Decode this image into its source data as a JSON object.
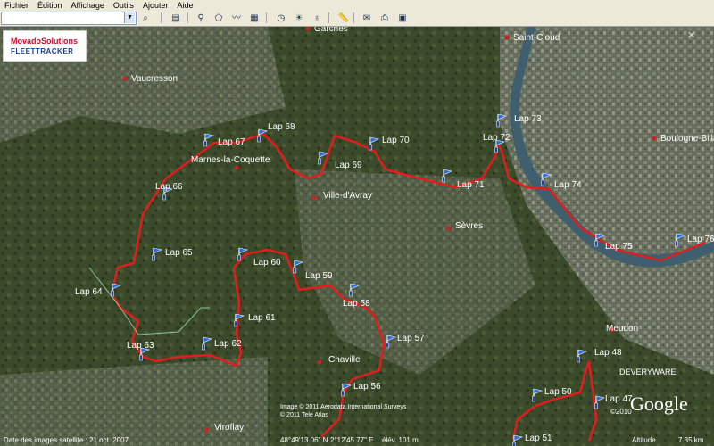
{
  "menu": [
    "Fichier",
    "Édition",
    "Affichage",
    "Outils",
    "Ajouter",
    "Aide"
  ],
  "search": {
    "value": ""
  },
  "toolbar_icons": [
    "sidebar-icon",
    "placemark-icon",
    "polygon-icon",
    "path-icon",
    "overlay-icon",
    "tour-icon",
    "history-icon",
    "sun-icon",
    "planet-icon",
    "ruler-icon",
    "email-icon",
    "print-icon",
    "maps-icon"
  ],
  "logo": {
    "line1": "MovadoSolutions",
    "line2": "FLEETTRACKER"
  },
  "places": [
    {
      "name": "Garches"
    },
    {
      "name": "Saint-Cloud"
    },
    {
      "name": "Vaucresson"
    },
    {
      "name": "Boulogne-Billancourt"
    },
    {
      "name": "Marnes-la-Coquette"
    },
    {
      "name": "Ville-d'Avray"
    },
    {
      "name": "Sèvres"
    },
    {
      "name": "Chaville"
    },
    {
      "name": "Meudon"
    },
    {
      "name": "Viroflay"
    }
  ],
  "laps": [
    "Lap 47",
    "Lap 48",
    "Lap 50",
    "Lap 51",
    "Lap 56",
    "Lap 57",
    "Lap 58",
    "Lap 59",
    "Lap 60",
    "Lap 61",
    "Lap 62",
    "Lap 63",
    "Lap 64",
    "Lap 65",
    "Lap 66",
    "Lap 67",
    "Lap 68",
    "Lap 69",
    "Lap 70",
    "Lap 71",
    "Lap 72",
    "Lap 73",
    "Lap 74",
    "Lap 75",
    "Lap 76"
  ],
  "colors": {
    "track": "#e21d1d",
    "flag": "#2e6fd8",
    "label": "#ffffff",
    "water": "#3f5f6e"
  },
  "credits": {
    "line1": "Image © 2011 Aerodata International Surveys",
    "line2": "© 2011 Tele Atlas"
  },
  "branding": {
    "google": "Google",
    "year": "©2010",
    "watermark": "DEVERYWARE"
  },
  "status": {
    "date": "Date des images satellite : 21 oct. 2007",
    "lat": "48°49'13.06\" N",
    "lon": "2°12'45.77\" E",
    "elev": "élév. 101 m",
    "altitude": "Altitude",
    "altitude_value": "7.35 km"
  }
}
